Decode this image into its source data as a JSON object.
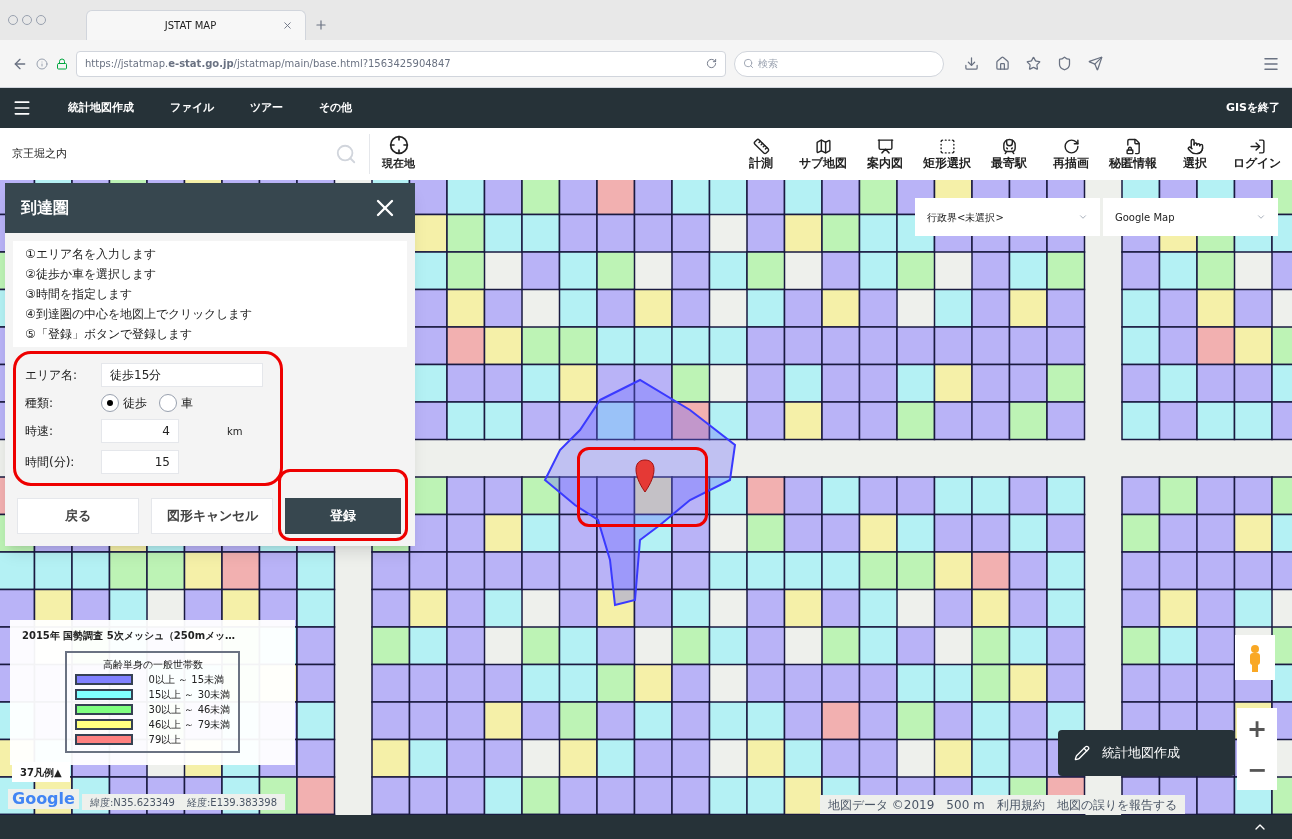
{
  "browser": {
    "tab_title": "JSTAT MAP",
    "url": "https://jstatmap.**e-stat.go.jp**/jstatmap/main/base.html?1563425904847",
    "search_placeholder": "検索"
  },
  "nav": {
    "items": [
      "統計地図作成",
      "ファイル",
      "ツアー",
      "その他"
    ],
    "exit": "GISを終了"
  },
  "toolbar": {
    "search_value": "京王堀之内",
    "location": "現在地",
    "tools": [
      {
        "kind": "measure",
        "label": "計測"
      },
      {
        "kind": "submap",
        "label": "サブ地図"
      },
      {
        "kind": "guide",
        "label": "案内図"
      },
      {
        "kind": "rect",
        "label": "矩形選択"
      },
      {
        "kind": "station",
        "label": "最寄駅"
      },
      {
        "kind": "redraw",
        "label": "再描画"
      },
      {
        "kind": "secret",
        "label": "秘匿情報"
      },
      {
        "kind": "select",
        "label": "選択"
      },
      {
        "kind": "login",
        "label": "ログイン"
      }
    ]
  },
  "panel": {
    "title": "到達圏",
    "instructions": [
      "①エリア名を入力します",
      "②徒歩か車を選択します",
      "③時間を指定します",
      "④到達圏の中心を地図上でクリックします",
      "⑤「登録」ボタンで登録します"
    ],
    "area_name_label": "エリア名:",
    "area_name": "徒歩15分",
    "type_label": "種類:",
    "types": [
      {
        "label": "徒歩",
        "selected": true
      },
      {
        "label": "車",
        "selected": false
      }
    ],
    "speed_label": "時速:",
    "speed": "4",
    "speed_unit": "km",
    "time_label": "時間(分):",
    "time": "15",
    "buttons": [
      {
        "label": "戻る",
        "kind": "plain"
      },
      {
        "label": "図形キャンセル",
        "kind": "plain"
      },
      {
        "label": "登録",
        "kind": "primary"
      }
    ]
  },
  "map": {
    "boundary_select": "行政界<未選択>",
    "basemap_select": "Google Map",
    "create_button": "統計地図作成",
    "zoom_in": "+",
    "zoom_out": "−",
    "google": "Google",
    "coords": [
      "緯度:N35.623349",
      "経度:E139.383398"
    ],
    "attribution": [
      "地図データ ©2019",
      "500 m",
      "利用規約",
      "地図の誤りを報告する"
    ]
  },
  "legend": {
    "title": "2015年 国勢調査 5次メッシュ（250mメッ…",
    "header": "高齢単身の一般世帯数",
    "toggle": "37凡例▲",
    "rows": [
      {
        "label": "0以上 ～ 15未満",
        "color": "#8080ff"
      },
      {
        "label": "15以上 ～ 30未満",
        "color": "#80ffff"
      },
      {
        "label": "30以上 ～ 46未満",
        "color": "#80ff80"
      },
      {
        "label": "46以上 ～ 79未満",
        "color": "#ffff80"
      },
      {
        "label": "79以上",
        "color": "#ff8080"
      }
    ]
  }
}
